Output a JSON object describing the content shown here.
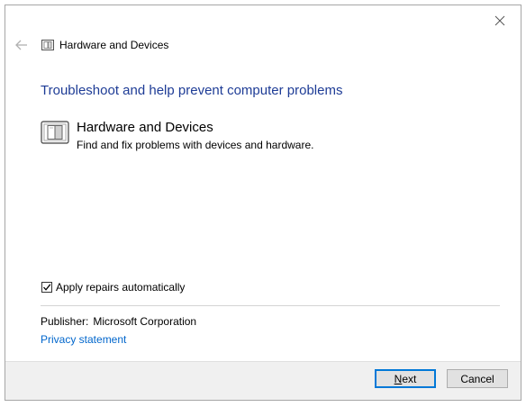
{
  "window": {
    "title": "Hardware and Devices"
  },
  "icons": {
    "back": "back-arrow-icon",
    "close": "close-icon",
    "title": "hardware-devices-icon",
    "item": "hardware-devices-icon"
  },
  "main": {
    "heading": "Troubleshoot and help prevent computer problems",
    "item": {
      "title": "Hardware and Devices",
      "description": "Find and fix problems with devices and hardware."
    },
    "apply_repairs": {
      "label": "Apply repairs automatically",
      "checked": true
    },
    "publisher_label": "Publisher:",
    "publisher_value": "Microsoft Corporation",
    "privacy_link": "Privacy statement"
  },
  "footer": {
    "next_label_first": "N",
    "next_label_rest": "ext",
    "cancel_label": "Cancel"
  },
  "colors": {
    "heading": "#1e3c96",
    "link": "#0066cc",
    "focus": "#0078d7"
  }
}
